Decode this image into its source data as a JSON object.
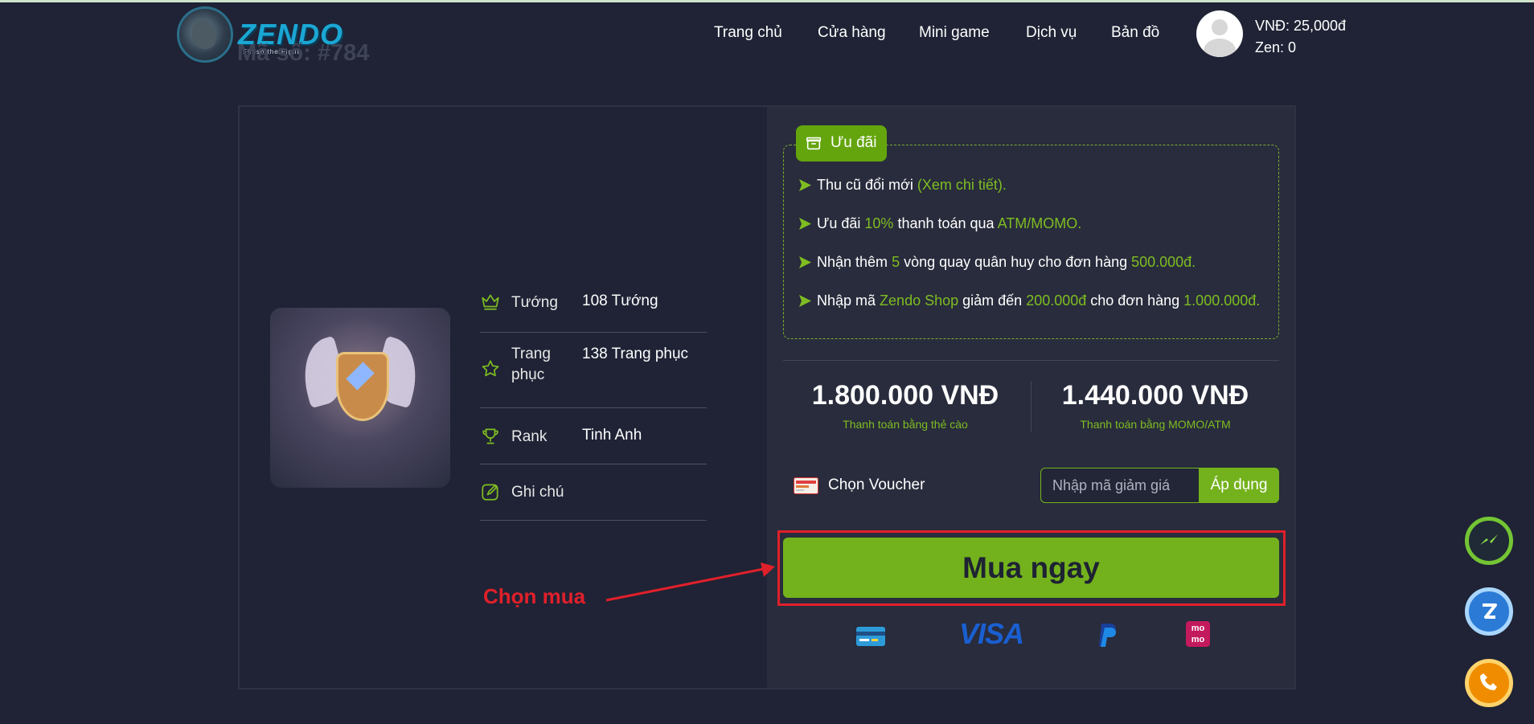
{
  "header": {
    "logo_text": "ZENDO",
    "logo_tagline": "Finish the Fight",
    "background_code": "Mã số: #784",
    "nav": [
      "Trang chủ",
      "Cửa hàng",
      "Mini game",
      "Dịch vụ",
      "Bản đồ"
    ],
    "wallet": {
      "vnd": "VNĐ: 25,000đ",
      "zen": "Zen: 0"
    }
  },
  "product": {
    "specs": [
      {
        "label": "Tướng",
        "value": "108 Tướng",
        "icon": "crown-icon"
      },
      {
        "label": "Trang phục",
        "value": "138 Trang phục",
        "icon": "star-icon"
      },
      {
        "label": "Rank",
        "value": "Tinh Anh",
        "icon": "trophy-icon"
      },
      {
        "label": "Ghi chú",
        "value": "",
        "icon": "edit-icon"
      }
    ]
  },
  "offers": {
    "title": "Ưu đãi",
    "items": [
      {
        "parts": [
          {
            "t": "Thu cũ đổi mới "
          },
          {
            "t": "(Xem chi tiết).",
            "hl": true
          }
        ]
      },
      {
        "parts": [
          {
            "t": "Ưu đãi "
          },
          {
            "t": "10%",
            "hl": true
          },
          {
            "t": " thanh toán qua "
          },
          {
            "t": "ATM/MOMO.",
            "hl": true
          }
        ]
      },
      {
        "parts": [
          {
            "t": "Nhận thêm "
          },
          {
            "t": "5",
            "hl": true
          },
          {
            "t": " vòng quay quân huy cho đơn hàng "
          },
          {
            "t": "500.000đ.",
            "hl": true
          }
        ]
      },
      {
        "parts": [
          {
            "t": "Nhập mã "
          },
          {
            "t": "Zendo Shop",
            "hl": true
          },
          {
            "t": " giảm đến "
          },
          {
            "t": "200.000đ",
            "hl": true
          },
          {
            "t": " cho đơn hàng "
          },
          {
            "t": "1.000.000đ.",
            "hl": true
          }
        ]
      }
    ]
  },
  "prices": {
    "card": {
      "amount": "1.800.000 VNĐ",
      "label": "Thanh toán bằng thẻ cào"
    },
    "momo": {
      "amount": "1.440.000 VNĐ",
      "label": "Thanh toán bằng MOMO/ATM"
    }
  },
  "voucher": {
    "label": "Chọn Voucher",
    "placeholder": "Nhập mã giảm giá",
    "apply": "Áp dụng"
  },
  "buy": {
    "label": "Mua ngay"
  },
  "annotation": {
    "text": "Chọn mua"
  },
  "payment_methods": {
    "visa": "VISA",
    "momo_top": "mo",
    "momo_bottom": "mo"
  },
  "colors": {
    "accent": "#74b21d",
    "highlight_text": "#7fbd22",
    "background": "#1f2335",
    "annotation": "#e0202a"
  }
}
